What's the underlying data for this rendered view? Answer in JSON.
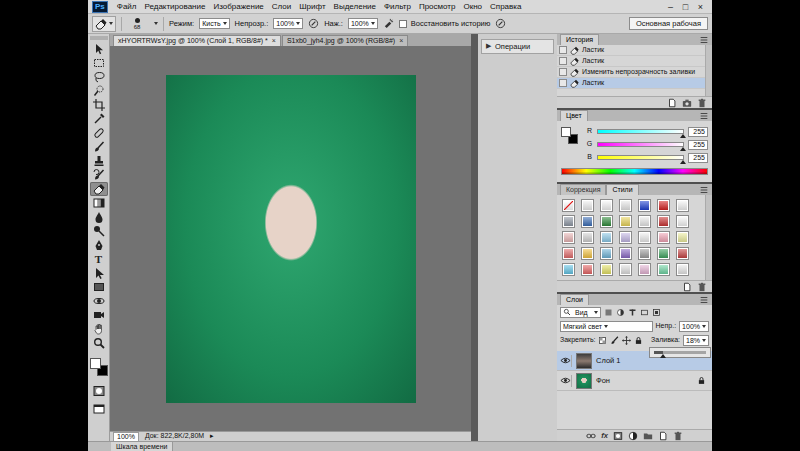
{
  "app": {
    "logo": "Ps"
  },
  "menu": [
    "Файл",
    "Редактирование",
    "Изображение",
    "Слои",
    "Шрифт",
    "Выделение",
    "Фильтр",
    "Просмотр",
    "Окно",
    "Справка"
  ],
  "window_controls": [
    "–",
    "□",
    "×"
  ],
  "options_bar": {
    "brush_size": "68",
    "mode_label": "Режим:",
    "mode": "Кисть",
    "opacity_label": "Непрозр.:",
    "opacity": "100%",
    "flow_label": "Наж.:",
    "flow": "100%",
    "restore_history": {
      "label": "Восстановить историю",
      "checked": false
    },
    "workspace": "Основная рабочая"
  },
  "document_tabs": [
    {
      "title": "xHYORTRWsY.jpg @ 100% (Слой 1, RGB/8#) *",
      "close": "×",
      "selected": true
    },
    {
      "title": "S1xb0_jyh4.jpg @ 100% (RGB/8#)",
      "close": "×",
      "selected": false
    }
  ],
  "tools": [
    {
      "kind": "move",
      "selected": false
    },
    {
      "kind": "marquee",
      "selected": false
    },
    {
      "kind": "lasso",
      "selected": false
    },
    {
      "kind": "quick-select",
      "selected": false
    },
    {
      "kind": "crop",
      "selected": false
    },
    {
      "kind": "eyedropper",
      "selected": false
    },
    {
      "kind": "healing",
      "selected": false
    },
    {
      "kind": "brush",
      "selected": false
    },
    {
      "kind": "stamp",
      "selected": false
    },
    {
      "kind": "history-brush",
      "selected": false
    },
    {
      "kind": "eraser",
      "selected": true
    },
    {
      "kind": "gradient",
      "selected": false
    },
    {
      "kind": "blur",
      "selected": false
    },
    {
      "kind": "dodge",
      "selected": false
    },
    {
      "kind": "pen",
      "selected": false
    },
    {
      "kind": "type",
      "glyph": "T",
      "selected": false
    },
    {
      "kind": "path-select",
      "selected": false
    },
    {
      "kind": "shape",
      "selected": false
    },
    {
      "kind": "rotate-3d",
      "selected": false
    },
    {
      "kind": "camera-3d",
      "selected": false
    },
    {
      "kind": "hand",
      "selected": false
    },
    {
      "kind": "zoom",
      "selected": false
    }
  ],
  "tool_colors": {
    "foreground": "#ffffff",
    "background": "#000000"
  },
  "status_bar": {
    "zoom": "100%",
    "info": "Док: 822,8K/2,80M",
    "arrow": "▸"
  },
  "timeline": {
    "label": "Шкала времени"
  },
  "actions_panel": {
    "icon": "▶",
    "label": "Операции"
  },
  "history": {
    "title": "История",
    "items": [
      {
        "label": "Ластик",
        "selected": false
      },
      {
        "label": "Ластик",
        "selected": false
      },
      {
        "label": "Изменить непрозрачность заливки",
        "selected": false
      },
      {
        "label": "Ластик",
        "selected": true
      }
    ]
  },
  "color": {
    "title": "Цвет",
    "channels": [
      {
        "name": "R",
        "value": "255",
        "level": 1,
        "color": "#00ffff"
      },
      {
        "name": "G",
        "value": "255",
        "level": 1,
        "color": "#ff00ff"
      },
      {
        "name": "B",
        "value": "255",
        "level": 1,
        "color": "#ffff00"
      }
    ]
  },
  "styles": {
    "tabs": [
      {
        "label": "Коррекция",
        "selected": false
      },
      {
        "label": "Стили",
        "selected": true
      }
    ],
    "swatches": [
      {
        "kind": "none",
        "color": "#ffffff"
      },
      {
        "kind": "style",
        "color": "#ededed"
      },
      {
        "kind": "style",
        "color": "#f4f4f4"
      },
      {
        "kind": "style",
        "color": "#e6e6e6"
      },
      {
        "kind": "style",
        "color": "#1d3fd0"
      },
      {
        "kind": "style",
        "color": "#d42020"
      },
      {
        "kind": "style",
        "color": "#f2f2f2"
      },
      {
        "kind": "style",
        "color": "#8d96a3"
      },
      {
        "kind": "style",
        "color": "#3b6db5"
      },
      {
        "kind": "style",
        "color": "#2f8a3a"
      },
      {
        "kind": "style",
        "color": "#e8d35a"
      },
      {
        "kind": "style",
        "color": "#e6e6e6"
      },
      {
        "kind": "style",
        "color": "#c93434"
      },
      {
        "kind": "style",
        "color": "#f5f5f5"
      },
      {
        "kind": "style",
        "color": "#e8b4b4"
      },
      {
        "kind": "style",
        "color": "#d0d0d0"
      },
      {
        "kind": "style",
        "color": "#8cc8e6"
      },
      {
        "kind": "style",
        "color": "#c2b6e4"
      },
      {
        "kind": "style",
        "color": "#ececec"
      },
      {
        "kind": "style",
        "color": "#f0a3b4"
      },
      {
        "kind": "style",
        "color": "#ecec9e"
      },
      {
        "kind": "style",
        "color": "#e06a6a"
      },
      {
        "kind": "style",
        "color": "#f0c040"
      },
      {
        "kind": "style",
        "color": "#6eb2d6"
      },
      {
        "kind": "style",
        "color": "#8a68c4"
      },
      {
        "kind": "style",
        "color": "#9c9c9c"
      },
      {
        "kind": "style",
        "color": "#3fa35f"
      },
      {
        "kind": "style",
        "color": "#c54343"
      },
      {
        "kind": "style",
        "color": "#62c3e4"
      },
      {
        "kind": "style",
        "color": "#e46464"
      },
      {
        "kind": "style",
        "color": "#e3e064"
      },
      {
        "kind": "style",
        "color": "#dedede"
      },
      {
        "kind": "style",
        "color": "#e3b3d3"
      },
      {
        "kind": "style",
        "color": "#6fd3a3"
      },
      {
        "kind": "style",
        "color": "#e6e6e6"
      }
    ]
  },
  "layers": {
    "title": "Слои",
    "filter": "Вид",
    "blend_mode": "Мягкий свет",
    "opacity_label": "Непр.:",
    "opacity": "100%",
    "lock_label": "Закрепить:",
    "fill_label": "Заливка:",
    "fill": "18%",
    "fill_slider_level": 0.18,
    "items": [
      {
        "name": "Слой 1",
        "selected": true,
        "visible": true,
        "locked": false
      },
      {
        "name": "Фон",
        "selected": false,
        "visible": true,
        "locked": true
      }
    ],
    "fx": "fx"
  }
}
